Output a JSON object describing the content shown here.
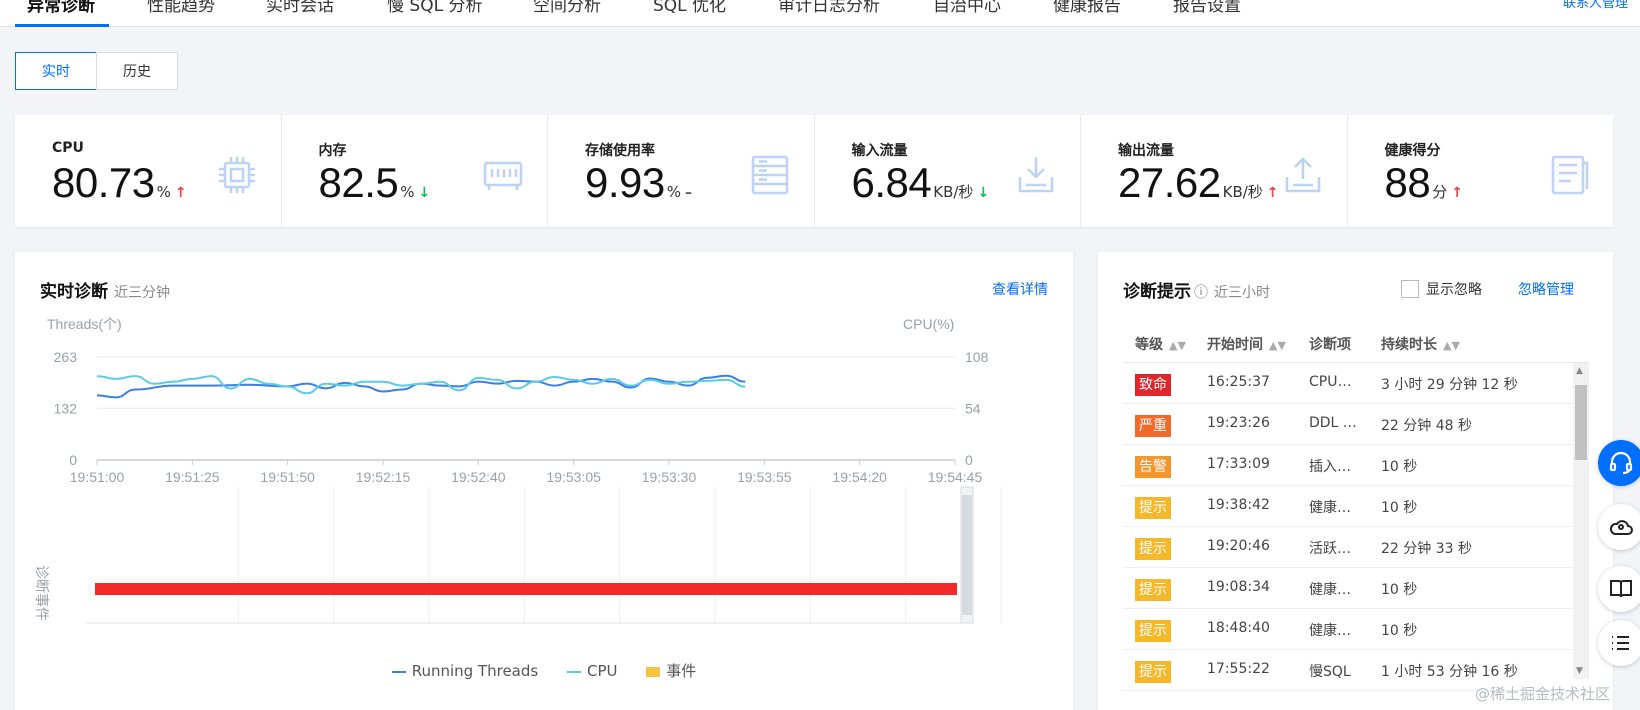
{
  "nav": {
    "tabs": [
      "异常诊断",
      "性能趋势",
      "实时会话",
      "慢 SQL 分析",
      "空间分析",
      "SQL 优化",
      "审计日志分析",
      "自治中心",
      "健康报告",
      "报告设置"
    ],
    "contact": "联系人管理"
  },
  "toggle": {
    "realtime": "实时",
    "history": "历史"
  },
  "metrics": [
    {
      "label": "CPU",
      "value": "80.73",
      "unit": "%",
      "trend": "up",
      "icon": "cpu-icon"
    },
    {
      "label": "内存",
      "value": "82.5",
      "unit": "%",
      "trend": "down",
      "icon": "memory-icon"
    },
    {
      "label": "存储使用率",
      "value": "9.93",
      "unit": "%",
      "trend": "flat",
      "icon": "storage-icon"
    },
    {
      "label": "输入流量",
      "value": "6.84",
      "unit": "KB/秒",
      "trend": "down",
      "icon": "download-icon"
    },
    {
      "label": "输出流量",
      "value": "27.62",
      "unit": "KB/秒",
      "trend": "up",
      "icon": "upload-icon"
    },
    {
      "label": "健康得分",
      "value": "88",
      "unit": "分",
      "trend": "up",
      "icon": "report-icon"
    }
  ],
  "colors": {
    "accent": "#006eff",
    "up": "#e54545",
    "down": "#0abf5b",
    "threads": "#3a7ee8",
    "cpu": "#5ccbe6",
    "event": "#f12a2a",
    "legend_event": "#f5c542"
  },
  "realtime": {
    "title": "实时诊断",
    "subtitle": "近三分钟",
    "link": "查看详情",
    "event_axis_label": "诊断事件",
    "legend": [
      "Running Threads",
      "CPU",
      "事件"
    ]
  },
  "chart_data": {
    "type": "line",
    "xlabel": "",
    "ylabel": "Threads(个)",
    "y2label": "CPU(%)",
    "x_ticks": [
      "19:51:00",
      "19:51:25",
      "19:51:50",
      "19:52:15",
      "19:52:40",
      "19:53:05",
      "19:53:30",
      "19:53:55",
      "19:54:20",
      "19:54:45"
    ],
    "y_ticks": [
      0,
      132,
      263
    ],
    "y2_ticks": [
      0,
      54,
      108
    ],
    "ylim": [
      0,
      263
    ],
    "y2lim": [
      0,
      108
    ],
    "grid": true,
    "series": [
      {
        "name": "Running Threads",
        "axis": "left",
        "x_seconds": [
          0,
          5,
          10,
          20,
          30,
          40,
          50,
          55,
          60,
          65,
          70,
          75,
          80,
          85,
          90,
          95,
          100,
          105,
          110,
          115,
          120,
          125,
          130,
          135,
          140,
          145,
          150,
          155,
          160,
          165,
          170
        ],
        "values": [
          165,
          160,
          180,
          190,
          190,
          192,
          188,
          195,
          183,
          197,
          188,
          175,
          180,
          195,
          190,
          188,
          200,
          195,
          202,
          200,
          190,
          200,
          207,
          200,
          185,
          208,
          200,
          190,
          210,
          215,
          200
        ]
      },
      {
        "name": "CPU",
        "axis": "right",
        "x_seconds": [
          0,
          5,
          10,
          15,
          20,
          25,
          30,
          35,
          40,
          45,
          50,
          55,
          60,
          65,
          70,
          75,
          80,
          85,
          90,
          95,
          100,
          105,
          110,
          115,
          120,
          125,
          130,
          135,
          140,
          145,
          150,
          155,
          160,
          165,
          170
        ],
        "values": [
          88,
          85,
          88,
          80,
          82,
          85,
          88,
          75,
          85,
          80,
          77,
          70,
          80,
          78,
          82,
          82,
          78,
          80,
          82,
          73,
          86,
          84,
          75,
          82,
          87,
          84,
          80,
          85,
          78,
          84,
          80,
          82,
          83,
          84,
          77
        ]
      }
    ],
    "events": [
      {
        "start": "19:51:00",
        "end": "19:54:45",
        "color": "#f12a2a"
      }
    ]
  },
  "tips": {
    "title": "诊断提示",
    "subtitle": "近三小时",
    "show_ignored": "显示忽略",
    "manage": "忽略管理",
    "columns": [
      "等级",
      "开始时间",
      "诊断项",
      "持续时长"
    ],
    "rows": [
      {
        "level": "致命",
        "color": "#e0262b",
        "time": "16:25:37",
        "item": "CPU…",
        "duration": "3 小时 29 分钟 12 秒"
      },
      {
        "level": "严重",
        "color": "#f06a2b",
        "time": "19:23:26",
        "item": "DDL …",
        "duration": "22 分钟 48 秒"
      },
      {
        "level": "告警",
        "color": "#f3962d",
        "time": "17:33:09",
        "item": "插入…",
        "duration": "10 秒"
      },
      {
        "level": "提示",
        "color": "#f6b82b",
        "time": "19:38:42",
        "item": "健康…",
        "duration": "10 秒"
      },
      {
        "level": "提示",
        "color": "#f6b82b",
        "time": "19:20:46",
        "item": "活跃…",
        "duration": "22 分钟 33 秒"
      },
      {
        "level": "提示",
        "color": "#f6b82b",
        "time": "19:08:34",
        "item": "健康…",
        "duration": "10 秒"
      },
      {
        "level": "提示",
        "color": "#f6b82b",
        "time": "18:48:40",
        "item": "健康…",
        "duration": "10 秒"
      },
      {
        "level": "提示",
        "color": "#f6b82b",
        "time": "17:55:22",
        "item": "慢SQL",
        "duration": "1 小时 53 分钟 16 秒"
      }
    ]
  },
  "watermark": "@稀土掘金技术社区"
}
